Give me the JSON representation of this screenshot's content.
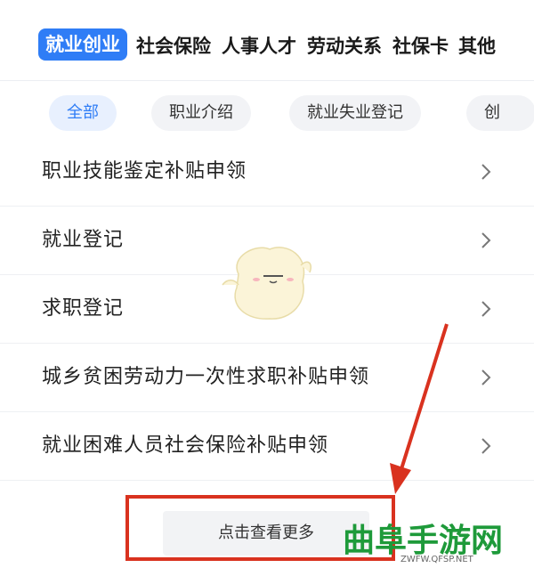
{
  "tabs": {
    "items": [
      "就业创业",
      "社会保险",
      "人事人才",
      "劳动关系",
      "社保卡",
      "其他"
    ],
    "active": "就业创业"
  },
  "chips": [
    "全部",
    "职业介绍",
    "就业失业登记",
    "创"
  ],
  "list": [
    {
      "label": "职业技能鉴定补贴申领"
    },
    {
      "label": "就业登记"
    },
    {
      "label": "求职登记"
    },
    {
      "label": "城乡贫困劳动力一次性求职补贴申领"
    },
    {
      "label": "就业困难人员社会保险补贴申领"
    }
  ],
  "more_button": "点击查看更多",
  "watermark": {
    "logo": "曲阜手游网",
    "site": "ZWFW.QFSP.NET"
  },
  "colors": {
    "accent": "#2f7df6",
    "annotation": "#d9321f",
    "watermark": "#1e9a3a"
  },
  "icons": [
    "chevron-right-icon",
    "mascot-illustration",
    "annotation-arrow"
  ]
}
